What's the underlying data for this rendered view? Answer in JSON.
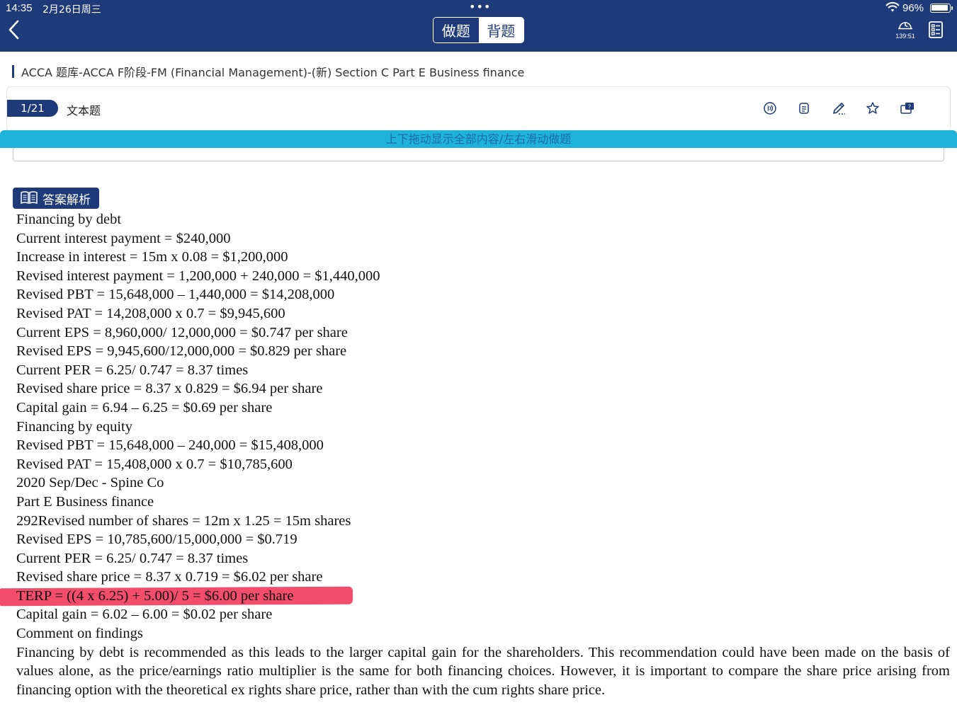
{
  "status_bar": {
    "time": "14:35",
    "date": "2月26日周三",
    "battery_pct": "96%",
    "dots": "•••"
  },
  "nav": {
    "mode_tabs": [
      {
        "label": "做题",
        "active": false
      },
      {
        "label": "背题",
        "active": true
      }
    ],
    "timer": "139:51"
  },
  "breadcrumb": "ACCA 题库-ACCA F阶段-FM (Financial Management)-(新) Section C  Part E Business finance",
  "question": {
    "index": "1/21",
    "type": "文本题"
  },
  "toolbar_icons": [
    "audio-icon",
    "notes-icon",
    "pencil-icon",
    "star-icon",
    "feedback-icon"
  ],
  "hint": "上下拖动显示全部内容/左右滑动做题",
  "answer": {
    "tag_label": "答案解析",
    "lines": [
      "Financing by debt",
      "Current interest payment = $240,000",
      "Increase in interest = 15m x 0.08 = $1,200,000",
      "Revised interest payment = 1,200,000 + 240,000 = $1,440,000",
      "Revised PBT = 15,648,000 – 1,440,000 = $14,208,000",
      "Revised PAT = 14,208,000 x 0.7 = $9,945,600",
      "Current EPS = 8,960,000/ 12,000,000 = $0.747 per share",
      "Revised EPS = 9,945,600/12,000,000 = $0.829 per share",
      "Current PER = 6.25/ 0.747 = 8.37 times",
      "Revised share price = 8.37 x 0.829 = $6.94 per share",
      "Capital gain = 6.94 – 6.25 = $0.69 per share",
      "Financing by equity",
      "Revised PBT = 15,648,000 – 240,000 = $15,408,000",
      "Revised PAT = 15,408,000 x 0.7 = $10,785,600",
      "2020 Sep/Dec - Spine Co",
      "Part E Business finance",
      "292Revised number of shares = 12m x 1.25 = 15m shares",
      "Revised EPS = 10,785,600/15,000,000 = $0.719",
      "Current PER = 6.25/ 0.747 = 8.37 times",
      "Revised share price = 8.37 x 0.719 = $6.02 per share",
      "TERP = ((4 x 6.25) + 5.00)/ 5 = $6.00 per share",
      "Capital gain = 6.02 – 6.00 = $0.02 per share",
      "Comment on findings"
    ],
    "highlighted_line_index": 20,
    "highlight_color": "#f24d6b",
    "paragraph": "Financing by debt is recommended as this leads to the larger capital gain for the shareholders. This recommendation could have been made on the basis of values alone, as the price/earnings ratio multiplier is the same for both financing choices. However, it is important to compare the share price arising from financing option with the theoretical ex rights share price, rather than with the cum rights share price."
  },
  "colors": {
    "nav_bg": "#1f3a78",
    "hint_bg": "#1fb3d9",
    "hint_text": "#1f6aa8"
  }
}
